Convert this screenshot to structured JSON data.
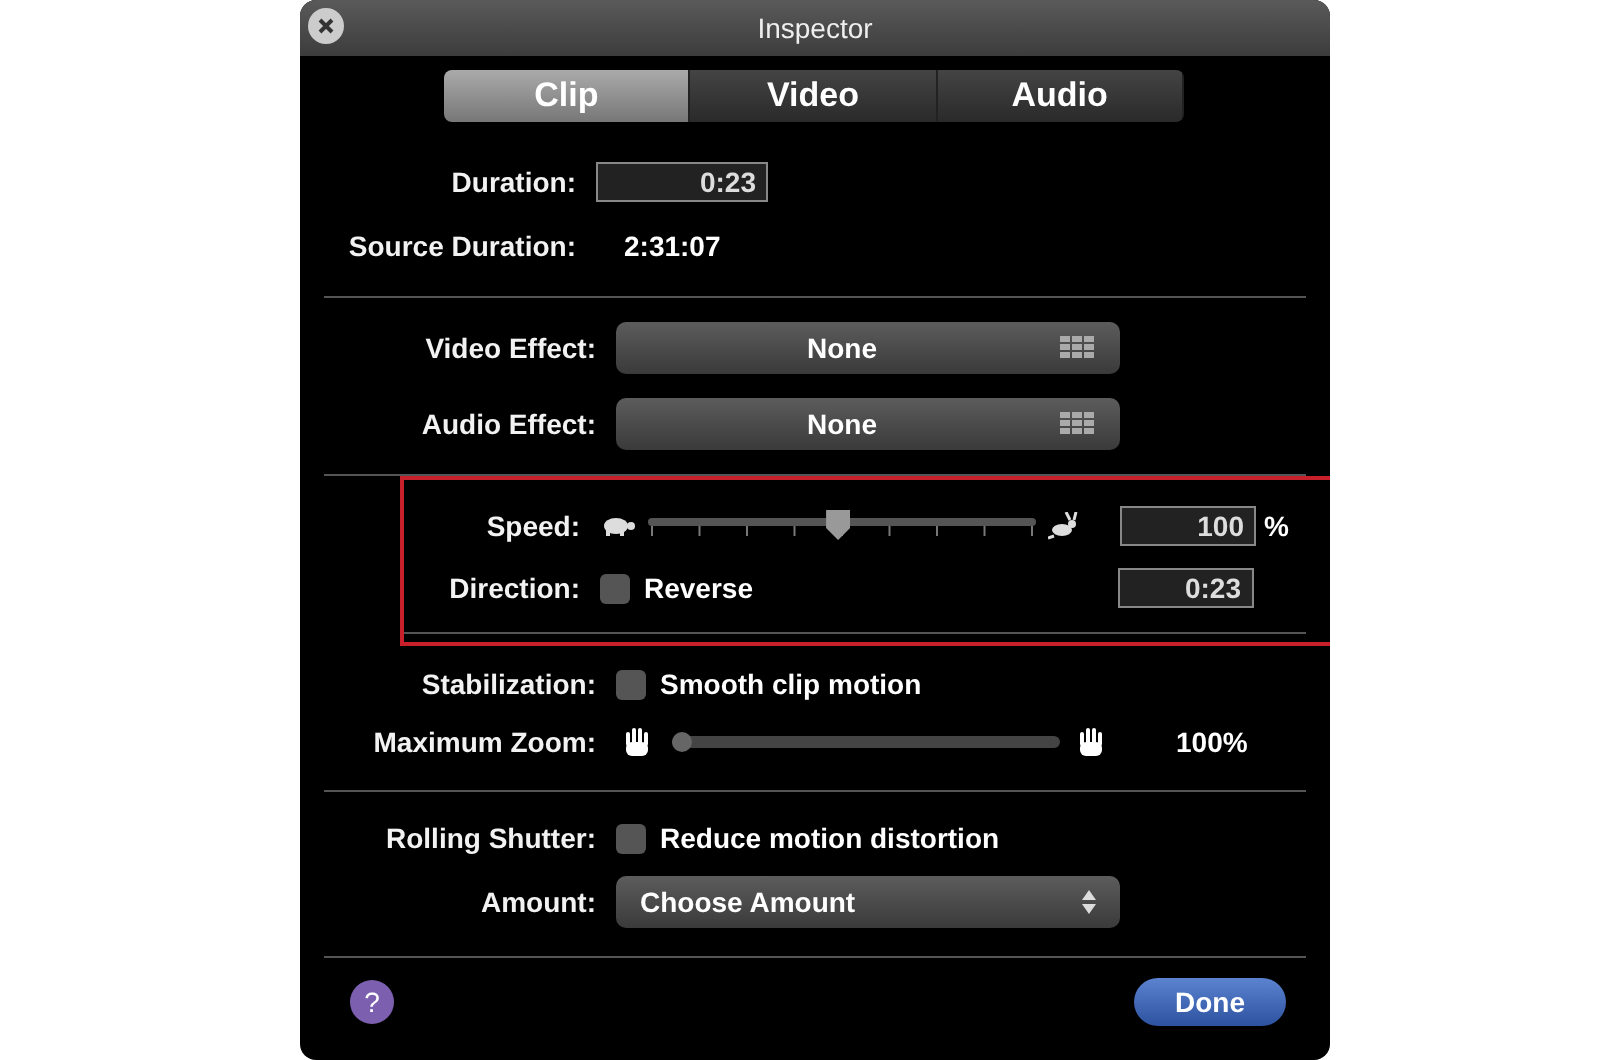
{
  "window": {
    "title": "Inspector"
  },
  "tabs": [
    {
      "label": "Clip",
      "selected": true
    },
    {
      "label": "Video",
      "selected": false
    },
    {
      "label": "Audio",
      "selected": false
    }
  ],
  "duration": {
    "label": "Duration:",
    "value": "0:23"
  },
  "source_duration": {
    "label": "Source Duration:",
    "value": "2:31:07"
  },
  "video_effect": {
    "label": "Video Effect:",
    "value": "None"
  },
  "audio_effect": {
    "label": "Audio Effect:",
    "value": "None"
  },
  "speed": {
    "label": "Speed:",
    "level": 0.49,
    "value": "100",
    "unit": "%"
  },
  "direction": {
    "label": "Direction:",
    "option": "Reverse",
    "checked": false,
    "value": "0:23"
  },
  "stabilization": {
    "label": "Stabilization:",
    "option": "Smooth clip motion",
    "checked": false
  },
  "maximum_zoom": {
    "label": "Maximum Zoom:",
    "level": 0,
    "reading": "100%"
  },
  "rolling_shutter": {
    "label": "Rolling Shutter:",
    "option": "Reduce motion distortion",
    "checked": false
  },
  "amount": {
    "label": "Amount:",
    "value": "Choose Amount"
  },
  "buttons": {
    "help": "?",
    "done": "Done"
  }
}
